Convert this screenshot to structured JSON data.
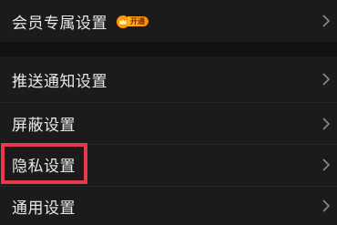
{
  "settings": {
    "vip_row": {
      "label": "会员专属设置",
      "badge_text": "开通"
    },
    "items": [
      {
        "label": "推送通知设置"
      },
      {
        "label": "屏蔽设置"
      },
      {
        "label": "隐私设置"
      },
      {
        "label": "通用设置"
      }
    ]
  },
  "colors": {
    "background": "#1b1b1b",
    "text": "#e9e9e9",
    "highlight": "#e8394d",
    "badge": "#ffb21f"
  },
  "icons": {
    "row_arrow": "chevron-right-icon",
    "vip": "crown-icon"
  }
}
